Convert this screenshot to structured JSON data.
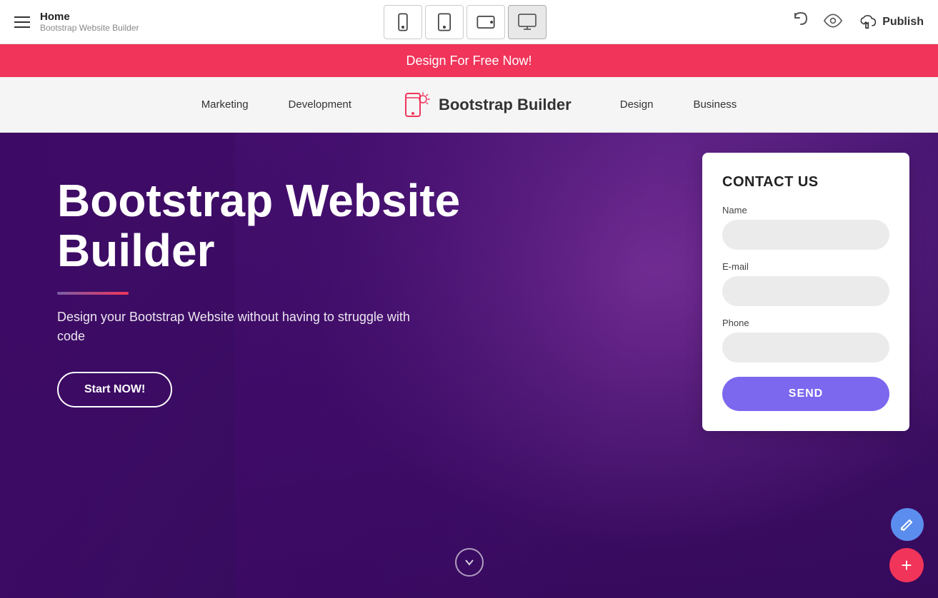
{
  "topbar": {
    "home_label": "Home",
    "subtitle": "Bootstrap Website Builder",
    "publish_label": "Publish"
  },
  "devices": [
    {
      "id": "mobile",
      "label": "Mobile"
    },
    {
      "id": "tablet",
      "label": "Tablet"
    },
    {
      "id": "tablet-landscape",
      "label": "Tablet Landscape"
    },
    {
      "id": "desktop",
      "label": "Desktop",
      "active": true
    }
  ],
  "promo": {
    "text": "Design For Free Now!"
  },
  "navbar": {
    "brand_name": "Bootstrap Builder",
    "items": [
      "Marketing",
      "Development",
      "Design",
      "Business"
    ]
  },
  "hero": {
    "title": "Bootstrap Website Builder",
    "subtitle": "Design your Bootstrap Website without having to struggle with code",
    "cta_label": "Start NOW!"
  },
  "contact": {
    "title": "CONTACT US",
    "name_label": "Name",
    "email_label": "E-mail",
    "phone_label": "Phone",
    "send_label": "SEND",
    "name_placeholder": "",
    "email_placeholder": "",
    "phone_placeholder": ""
  },
  "colors": {
    "promo_bg": "#f0345a",
    "send_btn": "#7b68ee",
    "fab_blue": "#5b8dee",
    "fab_red": "#f0345a"
  }
}
